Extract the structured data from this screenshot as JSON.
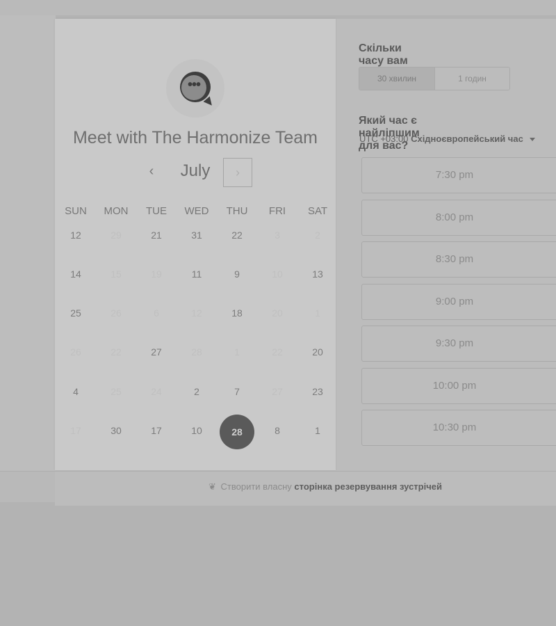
{
  "meeting": {
    "title": "Meet with The Harmonize Team",
    "logo_icon": "chat-bubble-dots-icon",
    "logo_dots": "•••"
  },
  "calendar": {
    "month": "July",
    "prev_label": "‹",
    "next_label": "›",
    "weekdays": [
      "SUN",
      "MON",
      "TUE",
      "WED",
      "THU",
      "FRI",
      "SAT"
    ],
    "weeks": [
      [
        {
          "d": "12",
          "off": false
        },
        {
          "d": "29",
          "off": true
        },
        {
          "d": "21",
          "off": false
        },
        {
          "d": "31",
          "off": false
        },
        {
          "d": "22",
          "off": false
        },
        {
          "d": "3",
          "off": true
        },
        {
          "d": "2",
          "off": true
        }
      ],
      [
        {
          "d": "14",
          "off": false
        },
        {
          "d": "15",
          "off": true
        },
        {
          "d": "19",
          "off": true
        },
        {
          "d": "11",
          "off": false
        },
        {
          "d": "9",
          "off": false
        },
        {
          "d": "10",
          "off": true
        },
        {
          "d": "13",
          "off": false
        }
      ],
      [
        {
          "d": "25",
          "off": false
        },
        {
          "d": "26",
          "off": true
        },
        {
          "d": "6",
          "off": true
        },
        {
          "d": "12",
          "off": true
        },
        {
          "d": "18",
          "off": false
        },
        {
          "d": "20",
          "off": true
        },
        {
          "d": "1",
          "off": true
        }
      ],
      [
        {
          "d": "26",
          "off": true
        },
        {
          "d": "22",
          "off": true
        },
        {
          "d": "27",
          "off": false
        },
        {
          "d": "28",
          "off": true
        },
        {
          "d": "1",
          "off": true
        },
        {
          "d": "22",
          "off": true
        },
        {
          "d": "20",
          "off": false
        }
      ],
      [
        {
          "d": "4",
          "off": false
        },
        {
          "d": "25",
          "off": true
        },
        {
          "d": "24",
          "off": true
        },
        {
          "d": "2",
          "off": false
        },
        {
          "d": "7",
          "off": false
        },
        {
          "d": "27",
          "off": true
        },
        {
          "d": "23",
          "off": false
        }
      ],
      [
        {
          "d": "17",
          "off": true
        },
        {
          "d": "30",
          "off": false
        },
        {
          "d": "17",
          "off": false
        },
        {
          "d": "10",
          "off": false
        },
        {
          "d": "28",
          "off": false,
          "selected": true
        },
        {
          "d": "8",
          "off": false
        },
        {
          "d": "1",
          "off": false
        }
      ]
    ]
  },
  "duration": {
    "question": "Скільки часу вам потрібно?",
    "options": [
      "30 хвилин",
      "1 годин"
    ],
    "selected": "30 хвилин"
  },
  "time": {
    "question": "Який час є найліпшим для вас?",
    "tz_offset": "UTC +03:00",
    "tz_name": "Східноєвропейський час",
    "slots": [
      "7:30 pm",
      "8:00 pm",
      "8:30 pm",
      "9:00 pm",
      "9:30 pm",
      "10:00 pm",
      "10:30 pm"
    ]
  },
  "footer": {
    "icon": "hubspot-sprocket-icon",
    "icon_glyph": "❦",
    "prefix": "Створити власну",
    "link": "сторінка резервування зустрічей"
  }
}
